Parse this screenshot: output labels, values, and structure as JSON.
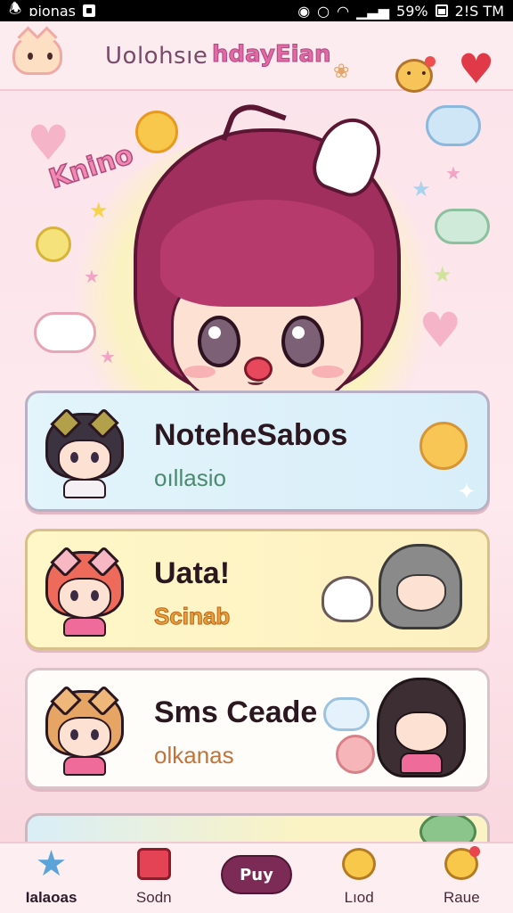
{
  "status_bar": {
    "left_text": "ɒionas",
    "battery": "59%",
    "time": "2!S TM"
  },
  "header": {
    "title_part1": "Uolohsıe",
    "title_part2": "hdayEian"
  },
  "hero": {
    "tag": "Knino"
  },
  "cards": [
    {
      "title": "NotehеSabos",
      "subtitle": "oıllasio"
    },
    {
      "title": "Uata!",
      "subtitle": "Scinab"
    },
    {
      "title": "Sms Ceade",
      "subtitle": "olkanas"
    }
  ],
  "bottom_nav": {
    "items": [
      {
        "label": "Ialaoas",
        "icon": "star-icon"
      },
      {
        "label": "Sodn",
        "icon": "box-icon"
      },
      {
        "label": "Puy",
        "icon": "pill-button"
      },
      {
        "label": "Lıod",
        "icon": "blob-icon"
      },
      {
        "label": "Raue",
        "icon": "blob-heart-icon"
      }
    ]
  },
  "colors": {
    "accent": "#7b2b55",
    "heart": "#e03a48",
    "header_pink": "#e06aa3"
  }
}
